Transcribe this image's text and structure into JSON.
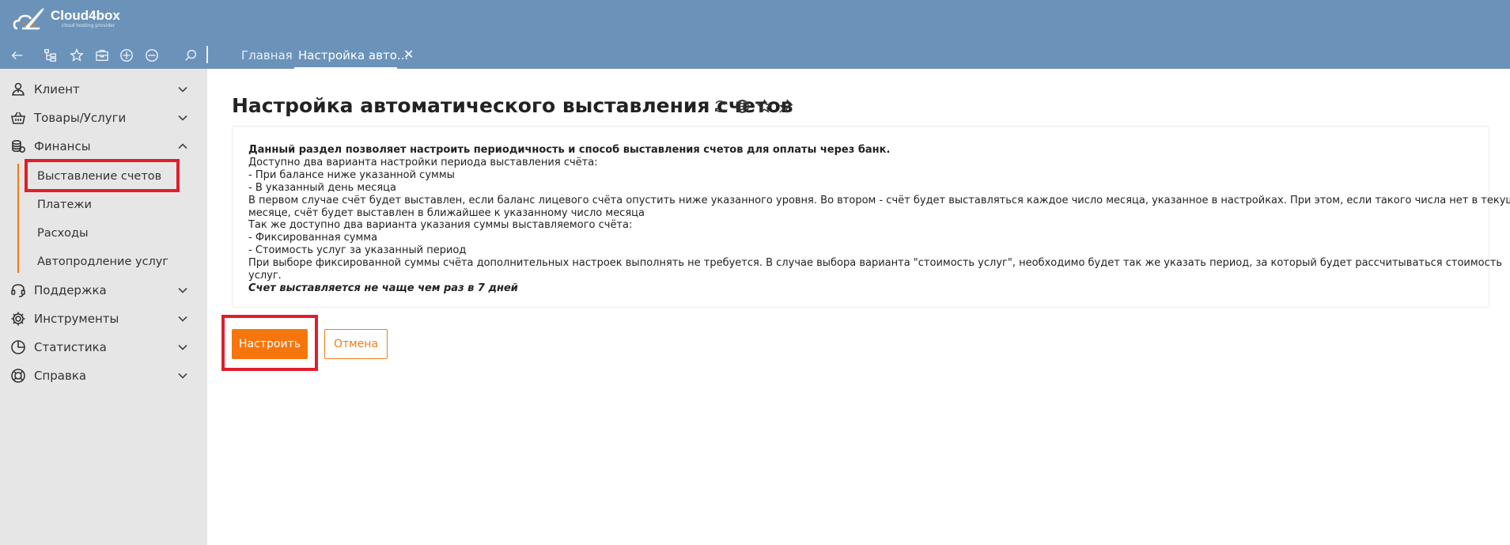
{
  "header": {
    "brand_name": "Cloud4box",
    "brand_tagline": "cloud hosting provider",
    "tabs": [
      {
        "label": "Главная",
        "active": false
      },
      {
        "label": "Настройка авто...",
        "active": true
      }
    ],
    "close_label": "✕",
    "toolbar_icons": [
      "back-arrow-icon",
      "tree-icon",
      "star-icon",
      "briefcase-icon",
      "plus-circle-icon",
      "minus-circle-icon",
      "search-icon"
    ]
  },
  "sidebar": {
    "items": [
      {
        "label": "Клиент",
        "icon": "client-icon",
        "expanded": false
      },
      {
        "label": "Товары/Услуги",
        "icon": "basket-icon",
        "expanded": false
      },
      {
        "label": "Финансы",
        "icon": "coins-icon",
        "expanded": true
      },
      {
        "label": "Поддержка",
        "icon": "headset-icon",
        "expanded": false
      },
      {
        "label": "Инструменты",
        "icon": "gear-icon",
        "expanded": false
      },
      {
        "label": "Статистика",
        "icon": "pie-chart-icon",
        "expanded": false
      },
      {
        "label": "Справка",
        "icon": "lifebuoy-icon",
        "expanded": false
      }
    ],
    "finance_sub": [
      {
        "label": "Выставление счетов",
        "active": true
      },
      {
        "label": "Платежи"
      },
      {
        "label": "Расходы"
      },
      {
        "label": "Автопродление услуг"
      }
    ]
  },
  "main": {
    "title": "Настройка автоматического выставления счетов",
    "title_icons": [
      "refresh-icon",
      "globe-icon",
      "star-icon",
      "pin-icon"
    ],
    "info": {
      "lines": [
        {
          "text": "Данный раздел позволяет настроить периодичность и способ выставления счетов для оплаты через банк.",
          "style": "bold"
        },
        {
          "text": "Доступно два варианта настройки периода выставления счёта:",
          "style": "normal"
        },
        {
          "text": "- При балансе ниже указанной суммы",
          "style": "normal"
        },
        {
          "text": "- В указанный день месяца",
          "style": "normal"
        },
        {
          "text": "В первом случае счёт будет выставлен, если баланс лицевого счёта опустить ниже указанного уровня. Во втором - счёт будет выставляться каждое число месяца, указанное в настройках. При этом, если такого числа нет в текущем",
          "style": "normal"
        },
        {
          "text": "месяце, счёт будет выставлен в ближайшее к указанному число месяца",
          "style": "normal"
        },
        {
          "text": "Так же доступно два варианта указания суммы выставляемого счёта:",
          "style": "normal"
        },
        {
          "text": "- Фиксированная сумма",
          "style": "normal"
        },
        {
          "text": "- Стоимость услуг за указанный период",
          "style": "normal"
        },
        {
          "text": "При выборе фиксированной суммы счёта дополнительных настроек выполнять не требуется. В случае выбора варианта \"стоимость услуг\", необходимо будет так же указать период, за который будет рассчитываться стоимость",
          "style": "normal"
        },
        {
          "text": "услуг.",
          "style": "normal"
        },
        {
          "text": "Счет выставляется не чаще чем раз в 7 дней",
          "style": "bold-italic"
        }
      ]
    },
    "buttons": {
      "configure_label": "Настроить",
      "cancel_label": "Отмена"
    }
  },
  "colors": {
    "header_bg": "#6b93ba",
    "sidebar_bg": "#e6e6e6",
    "accent": "#f6760d",
    "highlight": "#e01e2b"
  }
}
